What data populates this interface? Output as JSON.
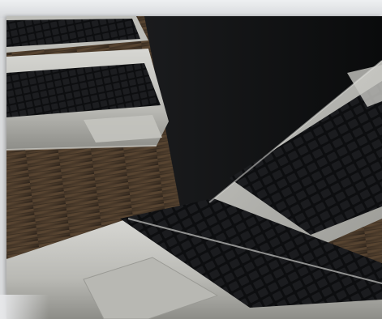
{
  "image": {
    "subject": "laptop-computers",
    "icon": "photo-icon"
  },
  "colors": {
    "background": "#d9dadc",
    "aluminum_light": "#cfcfcb",
    "aluminum_mid": "#a9a9a4",
    "aluminum_dark": "#6f6f6a",
    "keyboard": "#111214",
    "screen": "#0e0f10",
    "wood_dark": "#2a2119",
    "wood_light": "#5a4632"
  }
}
